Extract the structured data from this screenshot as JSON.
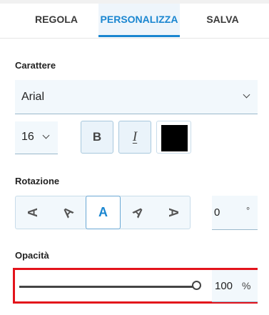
{
  "tabs": [
    {
      "label": "REGOLA"
    },
    {
      "label": "PERSONALIZZA",
      "active": true
    },
    {
      "label": "SALVA"
    }
  ],
  "font": {
    "section_label": "Carattere",
    "family": "Arial",
    "size": "16"
  },
  "format": {
    "bold_label": "B",
    "italic_label": "I",
    "color": "#000000"
  },
  "rotation": {
    "section_label": "Rotazione",
    "options": [
      "A",
      "A",
      "A",
      "A",
      "A"
    ],
    "selected_index": 2,
    "value": "0",
    "unit": "°"
  },
  "opacity": {
    "section_label": "Opacità",
    "value": "100",
    "unit": "%",
    "slider_fraction": 1.0
  }
}
